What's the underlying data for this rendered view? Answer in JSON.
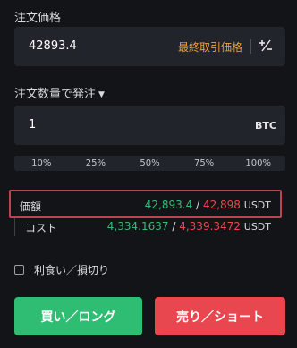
{
  "order_price": {
    "label": "注文価格",
    "value": "42893.4",
    "last_price_label": "最終取引価格",
    "adjust_icon": "plus-minus-icon"
  },
  "order_qty": {
    "label": "注文数量で発注",
    "dropdown_icon": "caret-down-icon",
    "value": "1",
    "unit": "BTC"
  },
  "percent_options": [
    "10%",
    "25%",
    "50%",
    "75%",
    "100%"
  ],
  "value_row": {
    "label": "価額",
    "low": "42,893.4",
    "sep": "/",
    "high": "42,898",
    "currency": "USDT"
  },
  "cost_row": {
    "label": "コスト",
    "low": "4,334.1637",
    "sep": "/",
    "high": "4,339.3472",
    "currency": "USDT"
  },
  "tp_sl": {
    "label": "利食い／損切り",
    "checked": false
  },
  "buttons": {
    "buy": "買い／ロング",
    "sell": "売り／ショート"
  },
  "colors": {
    "buy": "#2ebd73",
    "sell": "#e8474f",
    "accent": "#f0a03c",
    "highlight_box": "#b84550"
  }
}
